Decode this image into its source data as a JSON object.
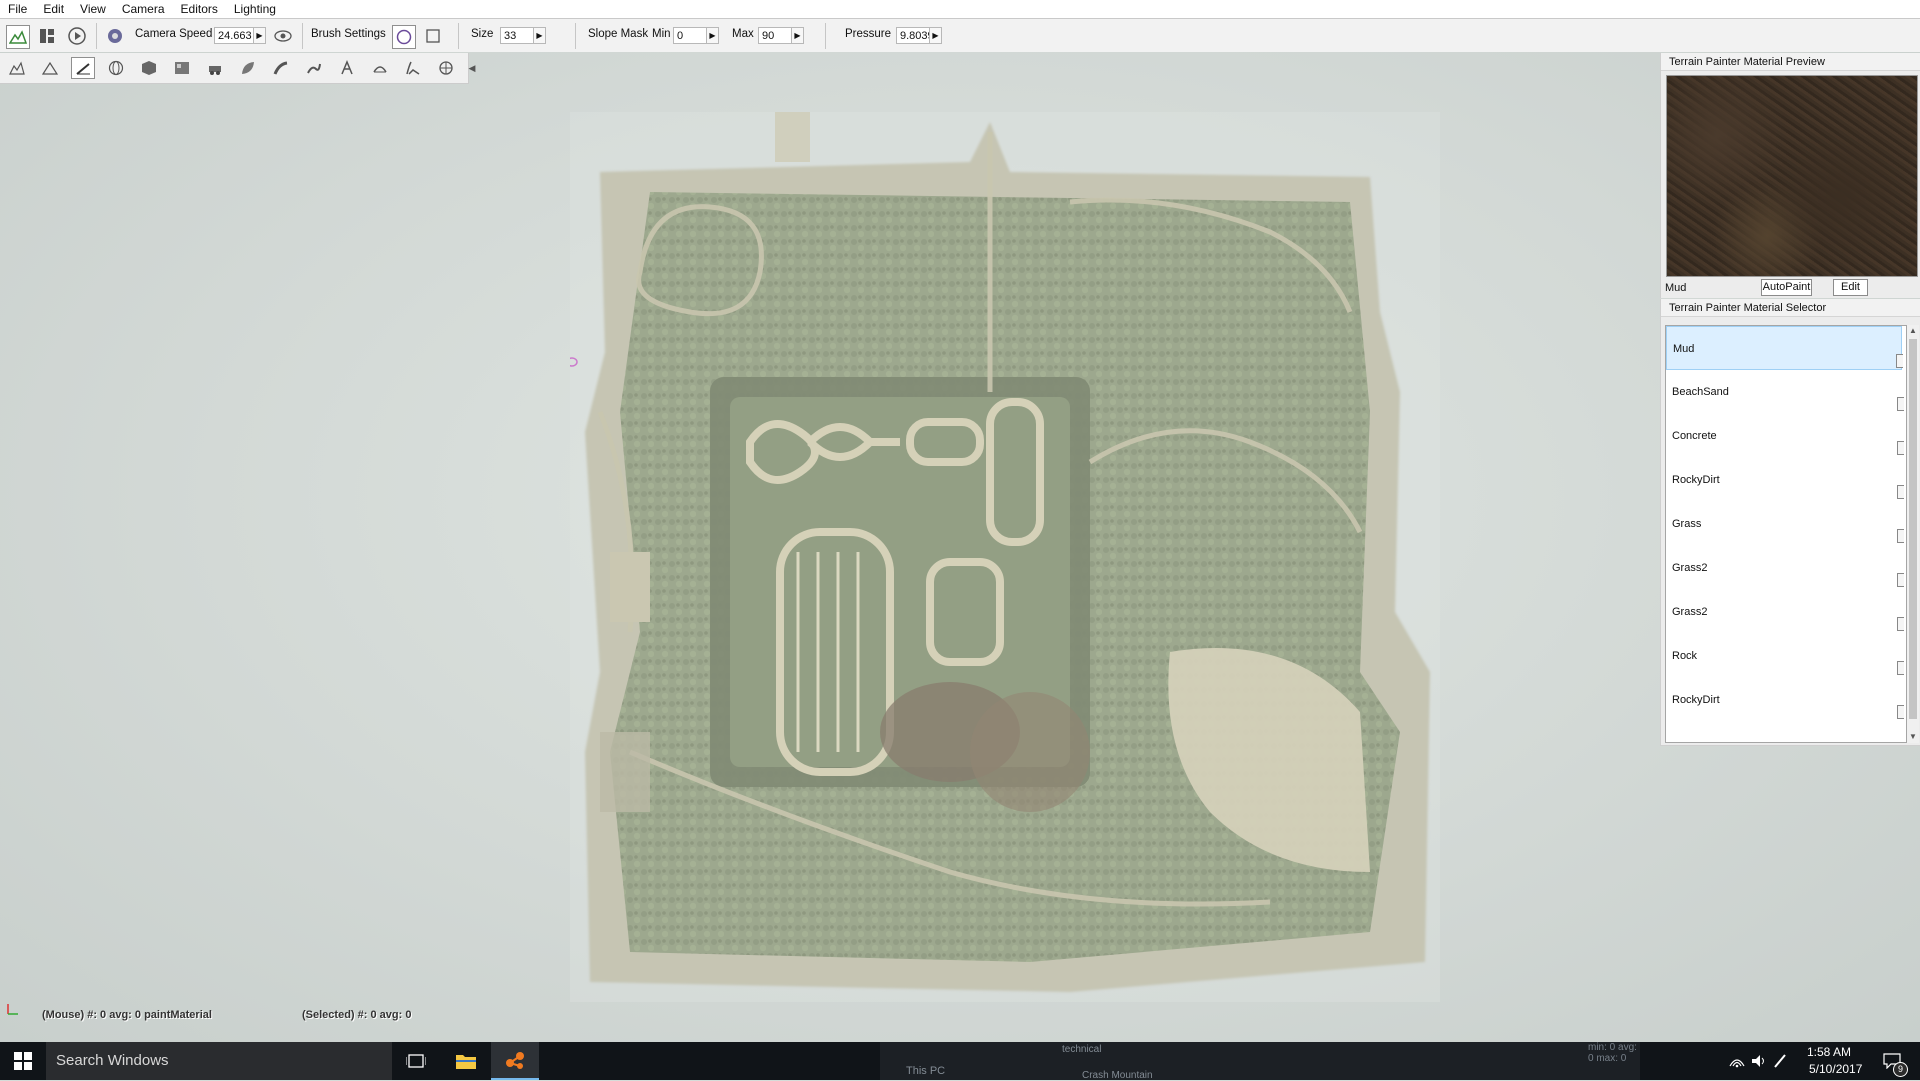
{
  "menubar": {
    "items": [
      "File",
      "Edit",
      "View",
      "Camera",
      "Editors",
      "Lighting"
    ]
  },
  "toolbar": {
    "camera_speed_label": "Camera Speed",
    "camera_speed_value": "24.663",
    "brush_settings_label": "Brush Settings",
    "size_label": "Size",
    "size_value": "33",
    "slope_mask_label": "Slope Mask",
    "min_label": "Min",
    "min_value": "0",
    "max_label": "Max",
    "max_value": "90",
    "pressure_label": "Pressure",
    "pressure_value": "9.8039"
  },
  "tool_palette": {
    "icons": [
      "terrain-raise-icon",
      "terrain-smooth-icon",
      "paint-brush-icon",
      "globe-icon",
      "cube-icon",
      "texture-icon",
      "vehicle-icon",
      "leaf-icon",
      "road-icon",
      "river-icon",
      "foliage-icon",
      "decal-icon",
      "grass-icon",
      "light-icon"
    ]
  },
  "preview_panel": {
    "title": "Terrain Painter Material Preview",
    "material_name": "Mud",
    "autopaint_label": "AutoPaint",
    "edit_label": "Edit"
  },
  "selector_panel": {
    "title": "Terrain Painter Material Selector",
    "materials": [
      "Mud",
      "BeachSand",
      "Concrete",
      "RockyDirt",
      "Grass",
      "Grass2",
      "Grass2",
      "Rock",
      "RockyDirt"
    ],
    "selected_index": 0
  },
  "viewport_status": {
    "mouse": "(Mouse) #: 0   avg: 0 paintMaterial",
    "selected": "(Selected) #: 0   avg: 0"
  },
  "taskbar": {
    "search_placeholder": "Search Windows",
    "background_window": {
      "stats": "min: 0  avg: 0  max: 0",
      "this_pc": "This PC",
      "row1_name": "technical",
      "row2_name": "Crash Mountain"
    },
    "time": "1:58 AM",
    "date": "5/10/2017",
    "notification_count": "9"
  },
  "colors": {
    "accent_blue": "#76b9ed",
    "selection_bg": "#dcefff",
    "terrain_green": "#6c7d55",
    "sand": "#c8c09e"
  }
}
